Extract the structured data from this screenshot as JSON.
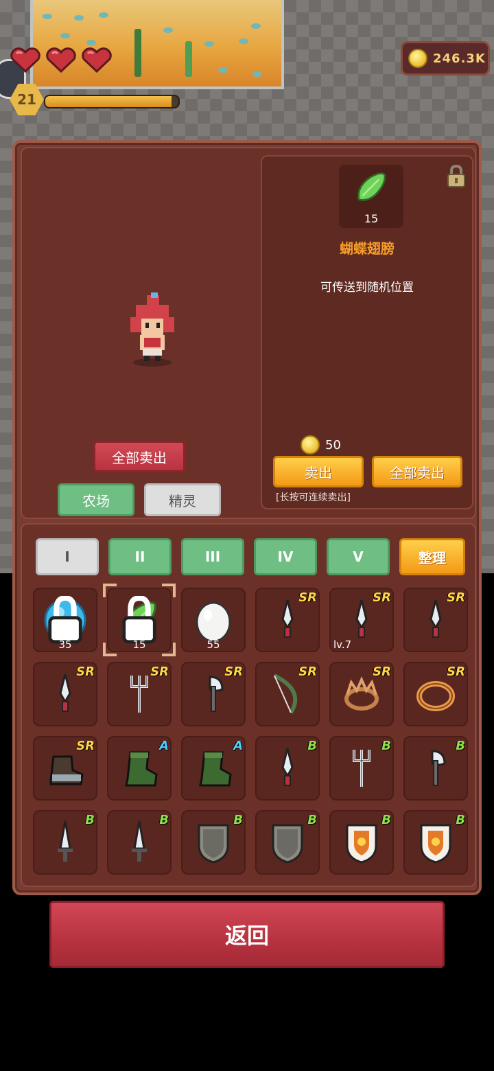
{
  "hud": {
    "level": "21",
    "xp_fraction": 0.95,
    "hearts": 3,
    "coins": "246.3K"
  },
  "character_area": {
    "sell_all_label": "全部卖出",
    "farm_tab": "农场",
    "spirit_tab": "精灵"
  },
  "detail": {
    "item_qty": "15",
    "item_name": "蝴蝶翅膀",
    "item_desc": "可传送到随机位置",
    "price": "50",
    "sell_label": "卖出",
    "sell_all_label": "全部卖出",
    "hint": "[长按可连续卖出]"
  },
  "tabs": {
    "t1": "I",
    "t2": "II",
    "t3": "III",
    "t4": "IV",
    "t5": "V",
    "sort": "整理"
  },
  "inventory": [
    {
      "icon": "blue-orb-icon",
      "qty": "35",
      "locked": true
    },
    {
      "icon": "butterfly-wing-icon",
      "qty": "15",
      "locked": true,
      "selected": true
    },
    {
      "icon": "egg-icon",
      "qty": "55"
    },
    {
      "icon": "dagger-icon",
      "rarity": "SR"
    },
    {
      "icon": "dagger-icon",
      "rarity": "SR",
      "level": "lv.7"
    },
    {
      "icon": "dagger-icon",
      "rarity": "SR"
    },
    {
      "icon": "dagger-icon",
      "rarity": "SR"
    },
    {
      "icon": "trident-icon",
      "rarity": "SR"
    },
    {
      "icon": "axe-icon",
      "rarity": "SR"
    },
    {
      "icon": "bow-icon",
      "rarity": "SR"
    },
    {
      "icon": "crown-ring-icon",
      "rarity": "SR"
    },
    {
      "icon": "gold-ring-icon",
      "rarity": "SR"
    },
    {
      "icon": "armored-boot-icon",
      "rarity": "SR"
    },
    {
      "icon": "green-boot-icon",
      "rarity": "A"
    },
    {
      "icon": "green-boot-icon",
      "rarity": "A"
    },
    {
      "icon": "dagger-icon",
      "rarity": "B"
    },
    {
      "icon": "trident-icon",
      "rarity": "B"
    },
    {
      "icon": "axe-icon",
      "rarity": "B"
    },
    {
      "icon": "sword-icon",
      "rarity": "B"
    },
    {
      "icon": "sword-icon",
      "rarity": "B"
    },
    {
      "icon": "stone-shield-icon",
      "rarity": "B"
    },
    {
      "icon": "stone-shield-icon",
      "rarity": "B"
    },
    {
      "icon": "fire-shield-icon",
      "rarity": "B"
    },
    {
      "icon": "fire-shield-icon",
      "rarity": "B"
    }
  ],
  "footer": {
    "back_label": "返回"
  }
}
